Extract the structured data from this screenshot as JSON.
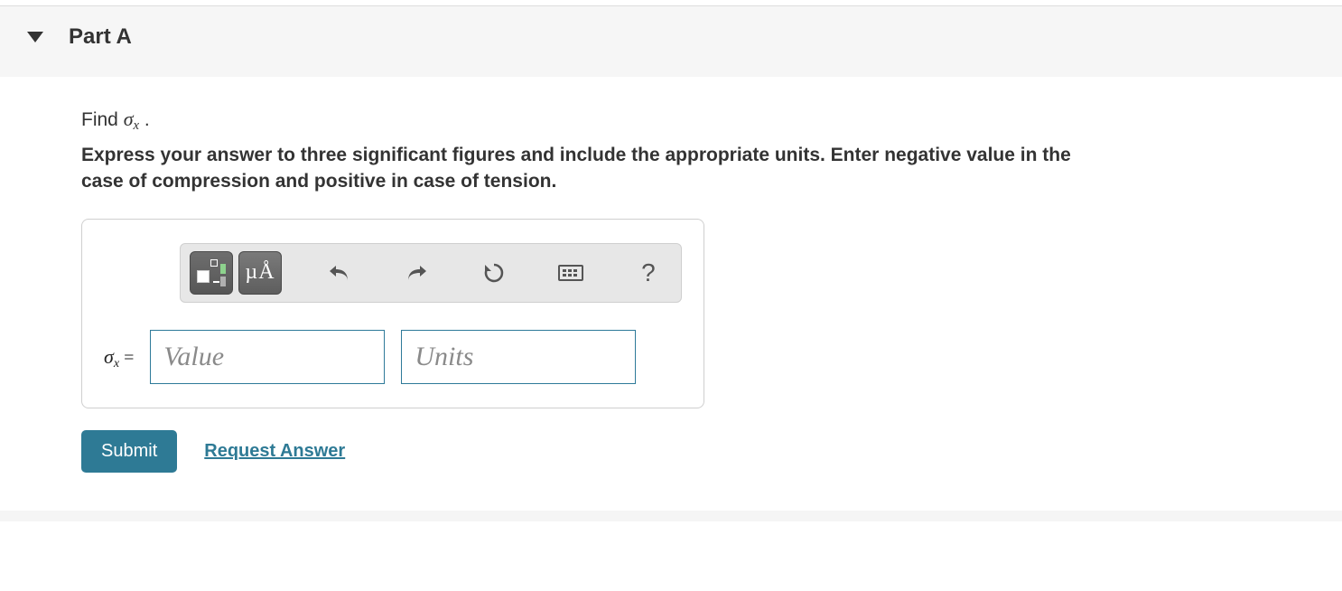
{
  "header": {
    "part_label": "Part A"
  },
  "prompt": {
    "prefix": "Find ",
    "symbol": "σ",
    "subscript": "x",
    "suffix": " ."
  },
  "instructions": "Express your answer to three significant figures and include the appropriate units. Enter negative value in the case of compression and positive in case of tension.",
  "toolbar": {
    "templates_title": "Templates",
    "symbols_title": "Symbols",
    "symbols_label": "µÅ",
    "undo_title": "Undo",
    "redo_title": "Redo",
    "reset_title": "Reset",
    "keyboard_title": "Keyboard shortcuts",
    "help_title": "Help",
    "help_label": "?"
  },
  "answer": {
    "label_symbol": "σ",
    "label_subscript": "x",
    "equals": "=",
    "value_placeholder": "Value",
    "units_placeholder": "Units"
  },
  "actions": {
    "submit_label": "Submit",
    "request_label": "Request Answer"
  }
}
